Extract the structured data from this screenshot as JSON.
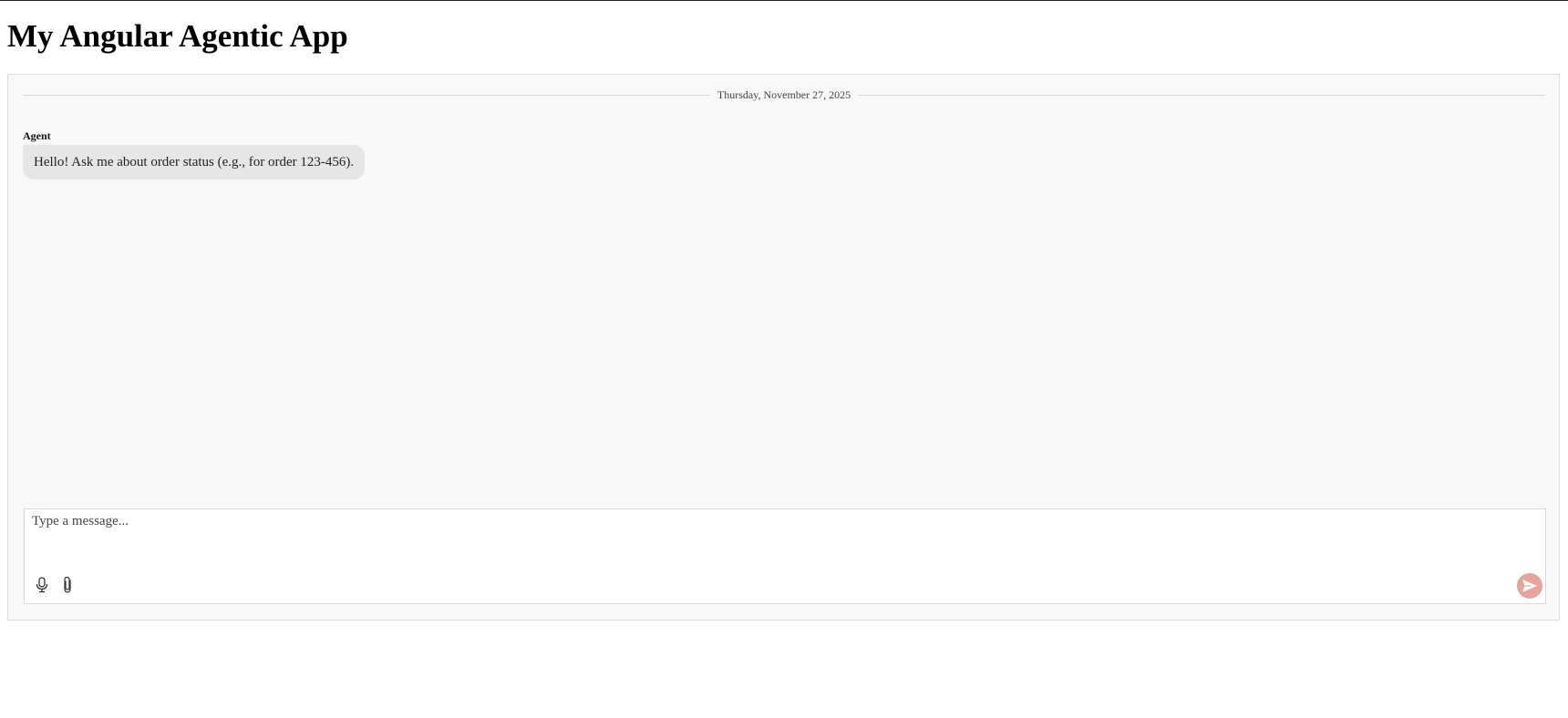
{
  "app": {
    "title": "My Angular Agentic App"
  },
  "chat": {
    "date_divider": "Thursday, November 27, 2025",
    "messages": [
      {
        "sender": "Agent",
        "text": "Hello! Ask me about order status (e.g., for order 123-456)."
      }
    ]
  },
  "composer": {
    "placeholder": "Type a message...",
    "value": "",
    "icons": {
      "mic": "microphone-icon",
      "attach": "paperclip-icon",
      "send": "send-icon"
    },
    "send_button_color": "#e8a39b",
    "agent_bubble_color": "#e6e6e6"
  }
}
